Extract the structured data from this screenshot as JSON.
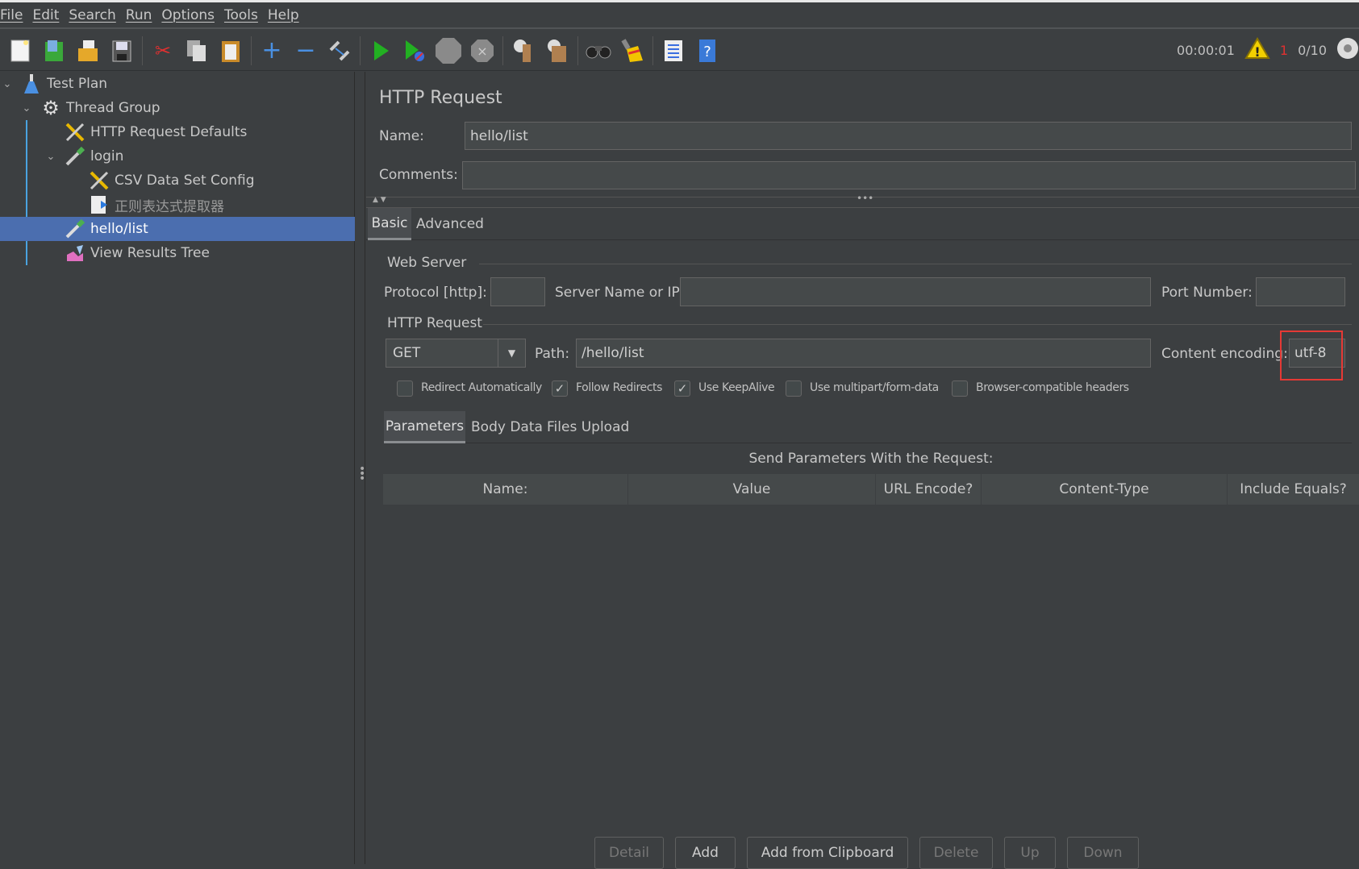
{
  "menu": [
    "File",
    "Edit",
    "Search",
    "Run",
    "Options",
    "Tools",
    "Help"
  ],
  "toolbar": {
    "icons": [
      "new-icon",
      "templates-icon",
      "open-icon",
      "save-icon",
      "cut-icon",
      "copy-icon",
      "paste-icon",
      "expand-icon",
      "collapse-icon",
      "toggle-icon",
      "start-icon",
      "start-no-pauses-icon",
      "stop-icon",
      "shutdown-icon",
      "clear-icon",
      "clear-all-icon",
      "search-icon",
      "reset-search-icon",
      "function-helper-icon",
      "help-icon"
    ]
  },
  "status": {
    "elapsed": "00:00:01",
    "warnings": "1",
    "threads": "0/10",
    "warning_color": "#e8c300",
    "error_count_color": "#e03030"
  },
  "tree": [
    {
      "label": "Test Plan",
      "icon": "flask-icon"
    },
    {
      "label": "Thread Group",
      "icon": "gear-icon"
    },
    {
      "label": "HTTP Request Defaults",
      "icon": "tools-icon"
    },
    {
      "label": "login",
      "icon": "pipette-icon"
    },
    {
      "label": "CSV Data Set Config",
      "icon": "tools-icon"
    },
    {
      "label": "正则表达式提取器",
      "icon": "extractor-icon"
    },
    {
      "label": "hello/list",
      "icon": "pipette-icon",
      "selected": true
    },
    {
      "label": "View Results Tree",
      "icon": "chart-icon"
    }
  ],
  "panel": {
    "title": "HTTP Request",
    "name_label": "Name:",
    "name_value": "hello/list",
    "comments_label": "Comments:",
    "comments_value": "",
    "tabs": [
      "Basic",
      "Advanced"
    ],
    "web_server": {
      "legend": "Web Server",
      "protocol_label": "Protocol [http]:",
      "protocol_value": "",
      "server_label": "Server Name or IP:",
      "server_value": "",
      "port_label": "Port Number:",
      "port_value": ""
    },
    "http_request": {
      "legend": "HTTP Request",
      "method": "GET",
      "path_label": "Path:",
      "path_value": "/hello/list",
      "encoding_label": "Content encoding:",
      "encoding_value": "utf-8",
      "highlight_color": "#e53935"
    },
    "checkboxes": [
      {
        "label": "Redirect Automatically",
        "checked": false
      },
      {
        "label": "Follow Redirects",
        "checked": true
      },
      {
        "label": "Use KeepAlive",
        "checked": true
      },
      {
        "label": "Use multipart/form-data",
        "checked": false
      },
      {
        "label": "Browser-compatible headers",
        "checked": false
      }
    ],
    "subtabs": [
      "Parameters",
      "Body Data",
      "Files Upload"
    ],
    "params_title": "Send Parameters With the Request:",
    "columns": [
      "Name:",
      "Value",
      "URL Encode?",
      "Content-Type",
      "Include Equals?"
    ],
    "buttons": [
      {
        "label": "Detail",
        "enabled": false
      },
      {
        "label": "Add",
        "enabled": true
      },
      {
        "label": "Add from Clipboard",
        "enabled": true
      },
      {
        "label": "Delete",
        "enabled": false
      },
      {
        "label": "Up",
        "enabled": false
      },
      {
        "label": "Down",
        "enabled": false
      }
    ]
  }
}
